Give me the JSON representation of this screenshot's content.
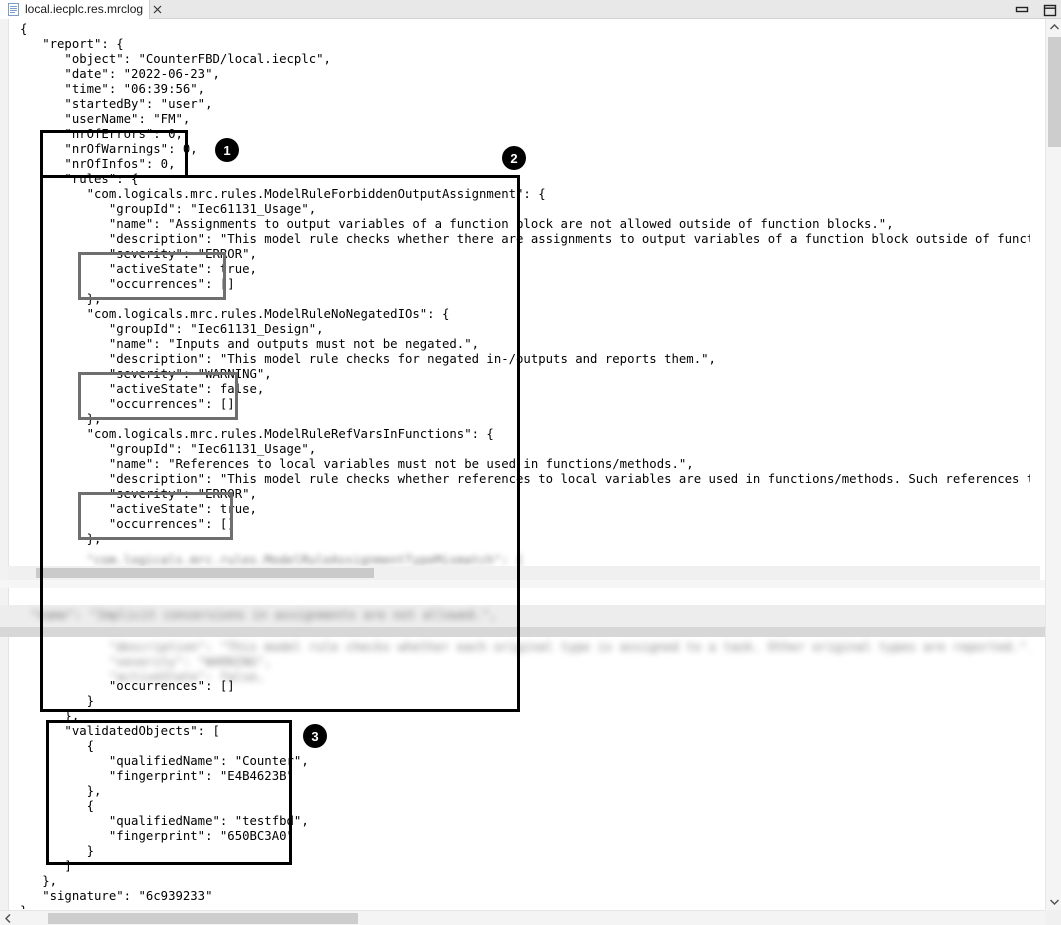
{
  "window": {
    "tab_label": "local.iecplc.res.mrclog",
    "tab_icon": "document-icon",
    "close_icon": "close-icon",
    "minimize_icon": "minimize-icon",
    "restore_icon": "restore-icon"
  },
  "editor": {
    "lines": [
      {
        "t": "{"
      },
      {
        "t": "   \"report\": {"
      },
      {
        "t": "      \"object\": \"CounterFBD/local.iecplc\","
      },
      {
        "t": "      \"date\": \"2022-06-23\","
      },
      {
        "t": "      \"time\": \"06:39:56\","
      },
      {
        "t": "      \"startedBy\": \"user\","
      },
      {
        "t": "      \"userName\": \"FM\","
      },
      {
        "t": "      \"nrOfErrors\": 0,"
      },
      {
        "t": "      \"nrOfWarnings\": 0,"
      },
      {
        "t": "      \"nrOfInfos\": 0,"
      },
      {
        "t": "      \"rules\": {"
      },
      {
        "t": "         \"com.logicals.mrc.rules.ModelRuleForbiddenOutputAssignment\": {"
      },
      {
        "t": "            \"groupId\": \"Iec61131_Usage\","
      },
      {
        "t": "            \"name\": \"Assignments to output variables of a function block are not allowed outside of function blocks.\","
      },
      {
        "t": "            \"description\": \"This model rule checks whether there are assignments to output variables of a function block outside of function blocks."
      },
      {
        "t": "            \"severity\": \"ERROR\","
      },
      {
        "t": "            \"activeState\": true,"
      },
      {
        "t": "            \"occurrences\": []"
      },
      {
        "t": "         },"
      },
      {
        "t": "         \"com.logicals.mrc.rules.ModelRuleNoNegatedIOs\": {"
      },
      {
        "t": "            \"groupId\": \"Iec61131_Design\","
      },
      {
        "t": "            \"name\": \"Inputs and outputs must not be negated.\","
      },
      {
        "t": "            \"description\": \"This model rule checks for negated in-/outputs and reports them.\","
      },
      {
        "t": "            \"severity\": \"WARNING\","
      },
      {
        "t": "            \"activeState\": false,"
      },
      {
        "t": "            \"occurrences\": []"
      },
      {
        "t": "         },"
      },
      {
        "t": "         \"com.logicals.mrc.rules.ModelRuleRefVarsInFunctions\": {"
      },
      {
        "t": "            \"groupId\": \"Iec61131_Usage\","
      },
      {
        "t": "            \"name\": \"References to local variables must not be used in functions/methods.\","
      },
      {
        "t": "            \"description\": \"This model rule checks whether references to local variables are used in functions/methods. Such references to local var"
      },
      {
        "t": "            \"severity\": \"ERROR\","
      },
      {
        "t": "            \"activeState\": true,"
      },
      {
        "t": "            \"occurrences\": []"
      },
      {
        "t": "         },"
      }
    ],
    "blurred_lines": [
      {
        "t": "         \"com.logicals.mrc.rules.ModelRuleAssignmentTypeMismatch\": {",
        "blur": true
      }
    ],
    "blurred_block": [
      {
        "t": "   \"name\": \"Implicit conversions in assignments are not allowed.\","
      },
      {
        "t": "            \"description\": \"This model rule checks whether each original type is assigned to a task. Other original types are reported.\","
      },
      {
        "t": "            \"severity\": \"WARNING\","
      },
      {
        "t": "            \"activeState\": false,"
      }
    ],
    "tail_lines": [
      {
        "t": "            \"occurrences\": []"
      },
      {
        "t": "         }"
      },
      {
        "t": "      },"
      },
      {
        "t": "      \"validatedObjects\": ["
      },
      {
        "t": "         {"
      },
      {
        "t": "            \"qualifiedName\": \"Counter\","
      },
      {
        "t": "            \"fingerprint\": \"E4B4623B\""
      },
      {
        "t": "         },"
      },
      {
        "t": "         {"
      },
      {
        "t": "            \"qualifiedName\": \"testfbd\","
      },
      {
        "t": "            \"fingerprint\": \"650BC3A0\""
      },
      {
        "t": "         }"
      },
      {
        "t": "      ]"
      },
      {
        "t": "   },"
      },
      {
        "t": "   \"signature\": \"6c939233\""
      },
      {
        "t": "}"
      }
    ]
  },
  "annotations": {
    "badges": [
      {
        "label": "1"
      },
      {
        "label": "2"
      },
      {
        "label": "3"
      }
    ]
  },
  "scrollbars": {
    "up_arrow": "chevron-up-icon",
    "down_arrow": "chevron-down-icon",
    "left_arrow": "chevron-left-icon"
  }
}
